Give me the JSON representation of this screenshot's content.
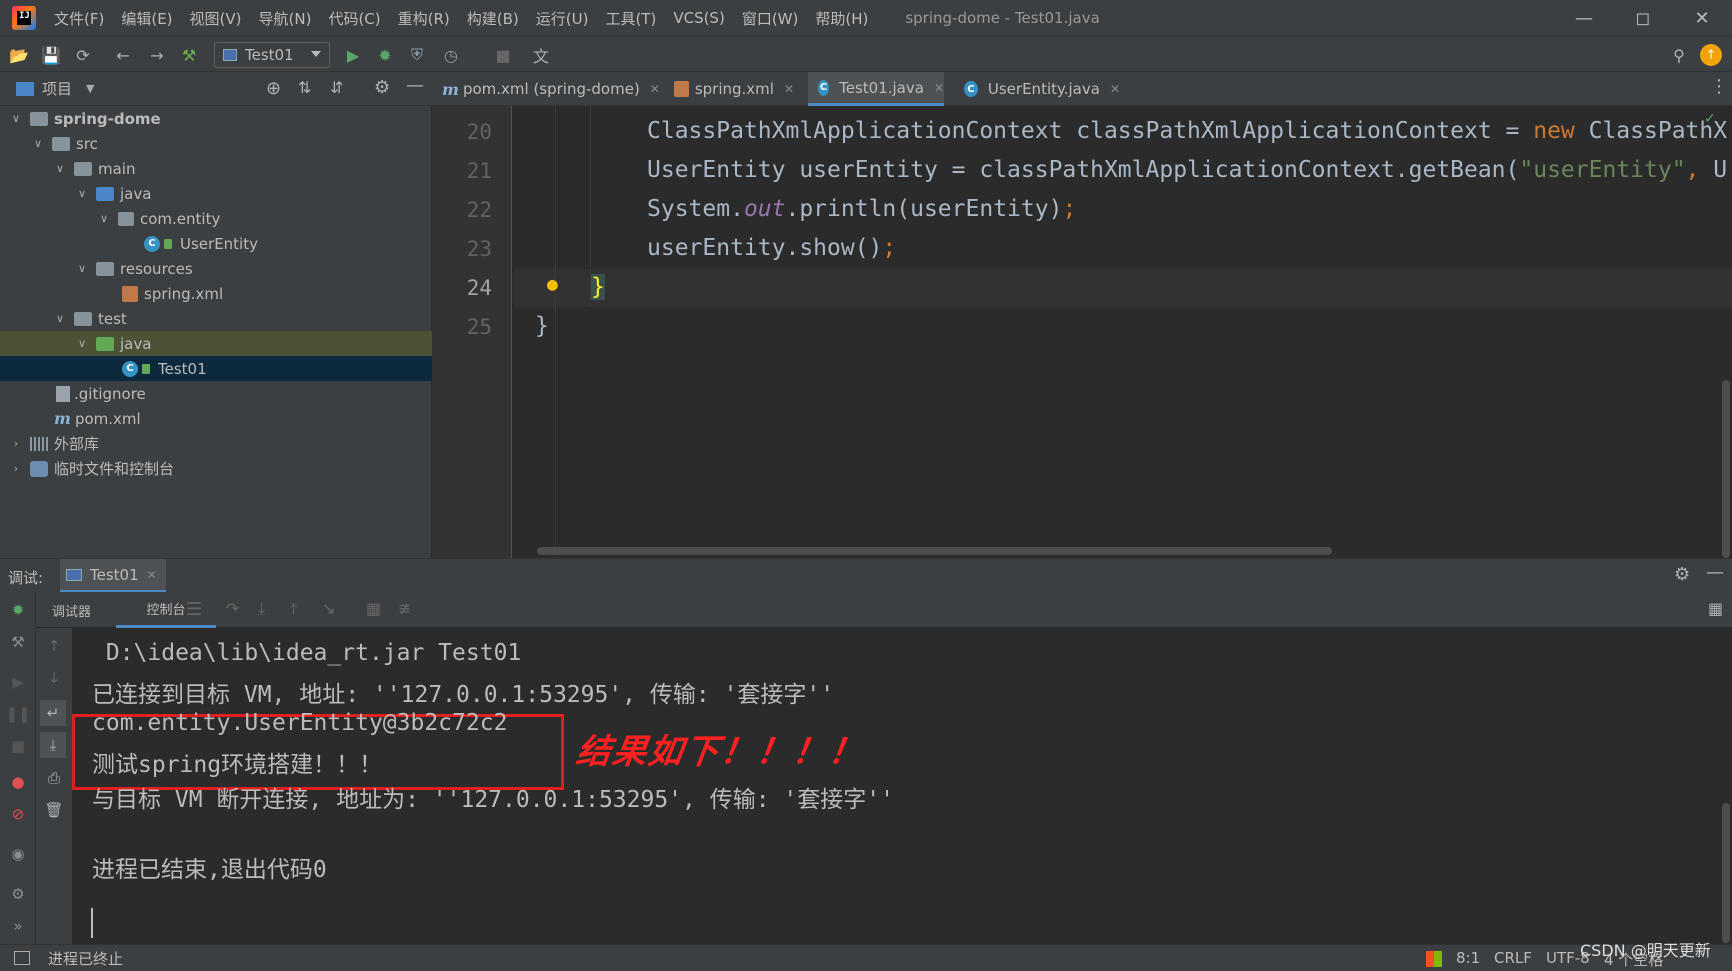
{
  "menu": [
    "文件(F)",
    "编辑(E)",
    "视图(V)",
    "导航(N)",
    "代码(C)",
    "重构(R)",
    "构建(B)",
    "运行(U)",
    "工具(T)",
    "VCS(S)",
    "窗口(W)",
    "帮助(H)"
  ],
  "window_title": "spring-dome - Test01.java",
  "toolbar": {
    "run_config": "Test01"
  },
  "project_panel": {
    "header": "项目",
    "tree": [
      {
        "label": "spring-dome",
        "bold": true
      },
      {
        "label": "src"
      },
      {
        "label": "main"
      },
      {
        "label": "java"
      },
      {
        "label": "com.entity"
      },
      {
        "label": "UserEntity"
      },
      {
        "label": "resources"
      },
      {
        "label": "spring.xml"
      },
      {
        "label": "test"
      },
      {
        "label": "java"
      },
      {
        "label": "Test01"
      },
      {
        "label": ".gitignore"
      },
      {
        "label": "pom.xml"
      },
      {
        "label": "外部库"
      },
      {
        "label": "临时文件和控制台"
      }
    ]
  },
  "editor": {
    "tabs": [
      {
        "label": "pom.xml (spring-dome)"
      },
      {
        "label": "spring.xml"
      },
      {
        "label": "Test01.java"
      },
      {
        "label": "UserEntity.java"
      }
    ],
    "active_tab": "Test01.java",
    "line_numbers": [
      "20",
      "21",
      "22",
      "23",
      "24",
      "25"
    ],
    "current_line": "24"
  },
  "debug": {
    "title": "调试:",
    "tab": "Test01",
    "subtabs": {
      "debugger": "调试器",
      "console": "控制台"
    },
    "console_lines": [
      " D:\\idea\\lib\\idea_rt.jar Test01",
      "已连接到目标 VM, 地址: ''127.0.0.1:53295', 传输: '套接字''",
      "com.entity.UserEntity@3b2c72c2",
      "测试spring环境搭建！！！",
      "与目标 VM 断开连接, 地址为: ''127.0.0.1:53295', 传输: '套接字''",
      "进程已结束,退出代码0"
    ],
    "annotation": "结果如下！！！！"
  },
  "statusbar": {
    "message": "进程已终止",
    "position": "8:1",
    "line_sep": "CRLF",
    "encoding": "UTF-8",
    "indent": "4 个空格",
    "watermark": "CSDN @明天更新"
  },
  "colors": {
    "accent": "#4a88c7",
    "result_box": "#e01f1f",
    "keyword": "#cc7832",
    "string": "#6a8759"
  }
}
